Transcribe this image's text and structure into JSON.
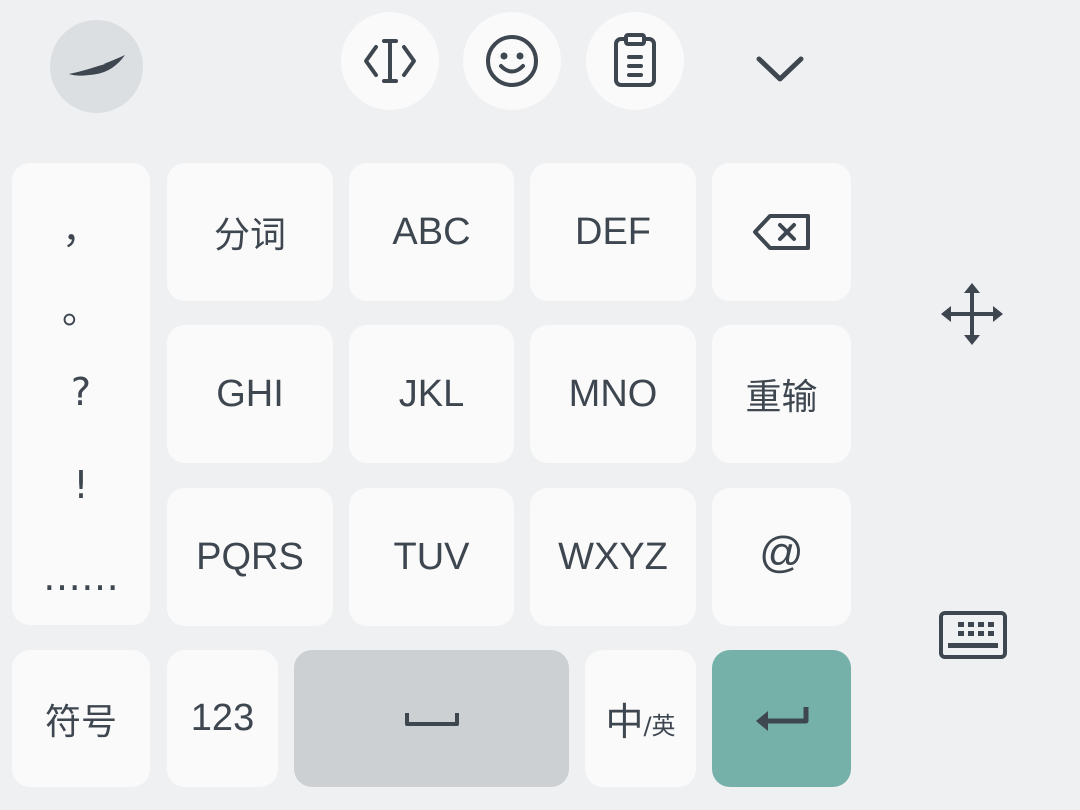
{
  "toolbar": {
    "logo_icon": "swift-bird-logo-icon",
    "cursor_icon": "text-cursor-icon",
    "emoji_icon": "smiley-face-icon",
    "clipboard_icon": "clipboard-icon",
    "collapse_icon": "chevron-down-icon"
  },
  "punctuation": [
    "，",
    "。",
    "?",
    "!",
    "……"
  ],
  "keys": {
    "row1": [
      "分词",
      "ABC",
      "DEF"
    ],
    "row2": [
      "GHI",
      "JKL",
      "MNO",
      "重输"
    ],
    "row3": [
      "PQRS",
      "TUV",
      "WXYZ",
      "@"
    ],
    "bottom": {
      "symbols": "符号",
      "numbers": "123",
      "lang_main": "中",
      "lang_sub": "/英"
    }
  },
  "icons": {
    "backspace": "backspace-icon",
    "move": "move-arrows-icon",
    "keyboard": "keyboard-icon",
    "space": "space-bar-icon",
    "enter": "enter-arrow-icon"
  },
  "colors": {
    "background": "#eef0f2",
    "key": "#fafafa",
    "space_key": "#cdd0d3",
    "enter_key": "#75b1a9",
    "text": "#3e4650"
  }
}
